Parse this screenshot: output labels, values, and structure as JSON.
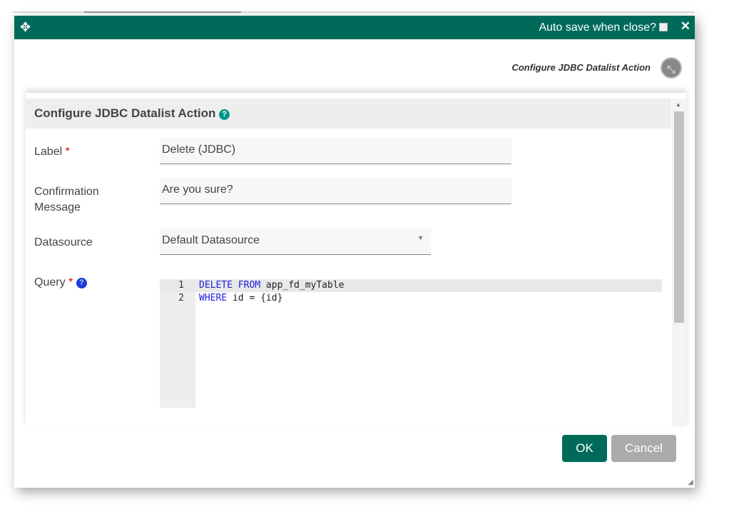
{
  "header": {
    "auto_save_label": "Auto save when close?",
    "close": "✕",
    "move": "✥"
  },
  "breadcrumb": "Configure JDBC Datalist Action",
  "section": {
    "title": "Configure JDBC Datalist Action"
  },
  "form": {
    "label": {
      "label": "Label",
      "value": "Delete (JDBC)"
    },
    "confirmation": {
      "label_line1": "Confirmation",
      "label_line2": "Message",
      "value": "Are you sure?"
    },
    "datasource": {
      "label": "Datasource",
      "value": "Default Datasource"
    },
    "query": {
      "label": "Query",
      "lines": [
        {
          "num": "1",
          "kw": "DELETE FROM",
          "rest": " app_fd_myTable"
        },
        {
          "num": "2",
          "kw": "WHERE",
          "rest": " id = {id}"
        }
      ]
    }
  },
  "buttons": {
    "ok": "OK",
    "cancel": "Cancel"
  }
}
